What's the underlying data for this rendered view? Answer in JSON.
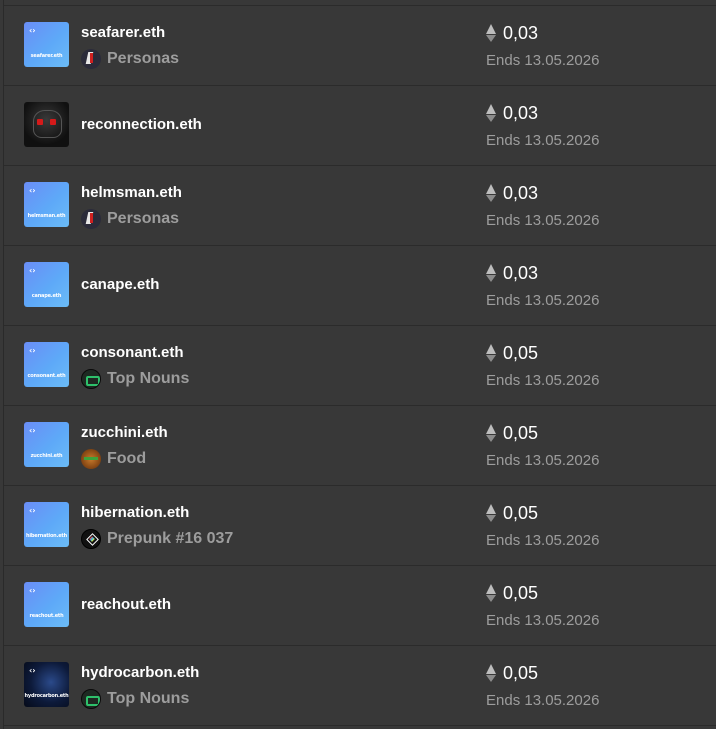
{
  "listings": [
    {
      "name": "seafarer.eth",
      "thumb_label": "seafarer.eth",
      "thumb_style": "blue",
      "collection": "Personas",
      "collection_icon": "personas-icon",
      "price": "0,03",
      "ends": "Ends 13.05.2026"
    },
    {
      "name": "reconnection.eth",
      "thumb_label": "",
      "thumb_style": "dark-red",
      "collection": "",
      "collection_icon": "",
      "price": "0,03",
      "ends": "Ends 13.05.2026"
    },
    {
      "name": "helmsman.eth",
      "thumb_label": "helmsman.eth",
      "thumb_style": "blue",
      "collection": "Personas",
      "collection_icon": "personas-icon",
      "price": "0,03",
      "ends": "Ends 13.05.2026"
    },
    {
      "name": "canape.eth",
      "thumb_label": "canape.eth",
      "thumb_style": "blue",
      "collection": "",
      "collection_icon": "",
      "price": "0,03",
      "ends": "Ends 13.05.2026"
    },
    {
      "name": "consonant.eth",
      "thumb_label": "consonant.eth",
      "thumb_style": "blue",
      "collection": "Top Nouns",
      "collection_icon": "nouns-icon",
      "price": "0,05",
      "ends": "Ends 13.05.2026"
    },
    {
      "name": "zucchini.eth",
      "thumb_label": "zucchini.eth",
      "thumb_style": "blue",
      "collection": "Food",
      "collection_icon": "food-icon",
      "price": "0,05",
      "ends": "Ends 13.05.2026"
    },
    {
      "name": "hibernation.eth",
      "thumb_label": "hibernation.eth",
      "thumb_style": "blue",
      "collection": "Prepunk #16 037",
      "collection_icon": "prepunk-icon",
      "price": "0,05",
      "ends": "Ends 13.05.2026"
    },
    {
      "name": "reachout.eth",
      "thumb_label": "reachout.eth",
      "thumb_style": "blue",
      "collection": "",
      "collection_icon": "",
      "price": "0,05",
      "ends": "Ends 13.05.2026"
    },
    {
      "name": "hydrocarbon.eth",
      "thumb_label": "hydrocarbon.eth",
      "thumb_style": "space",
      "collection": "Top Nouns",
      "collection_icon": "nouns-icon",
      "price": "0,05",
      "ends": "Ends 13.05.2026"
    }
  ],
  "colors": {
    "background": "#383838",
    "divider": "#2b2b2b",
    "muted_text": "#9d9d9d",
    "thumb_blue": "#6a8df6"
  }
}
